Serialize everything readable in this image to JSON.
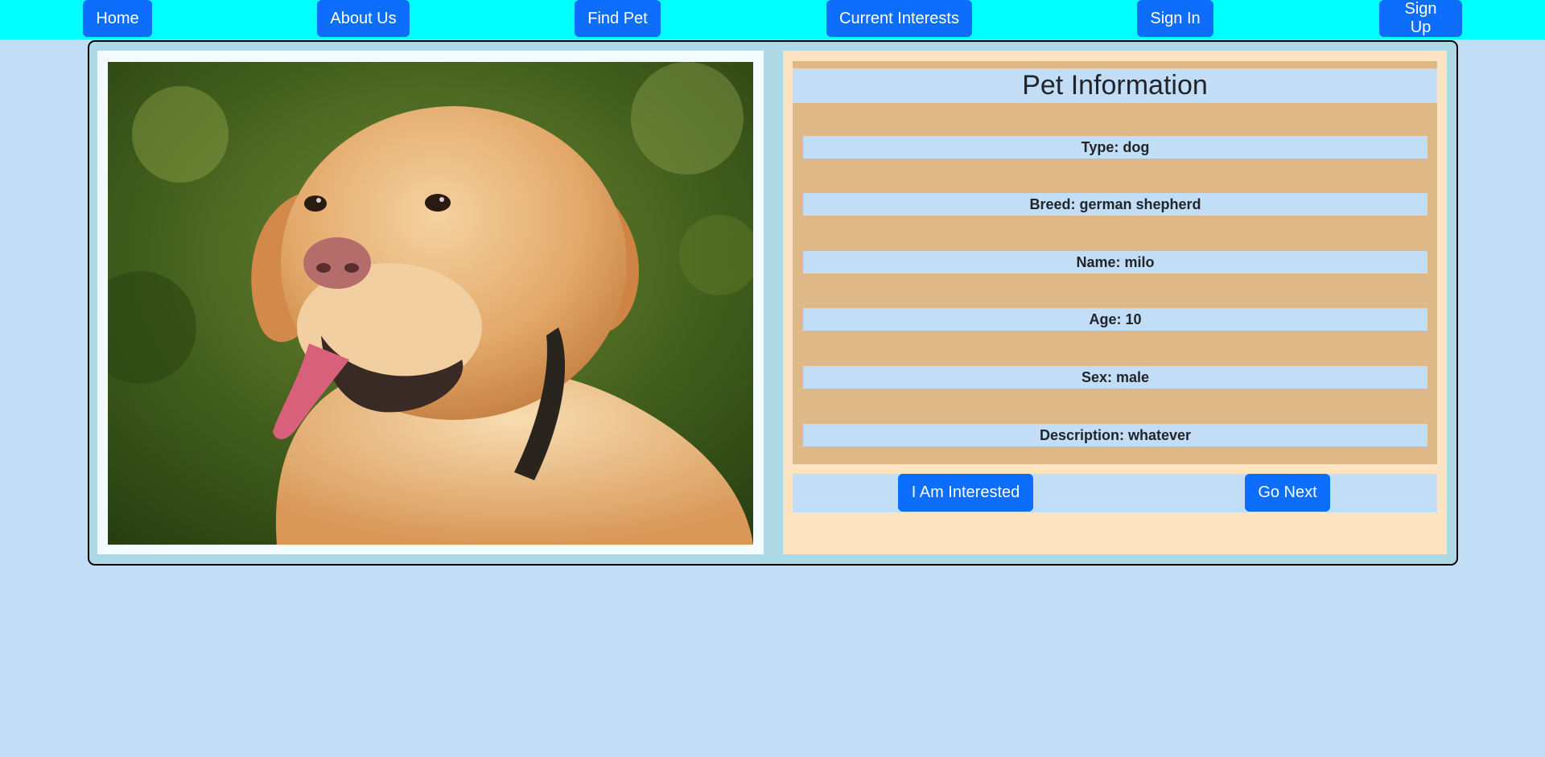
{
  "nav": {
    "home": "Home",
    "about": "About Us",
    "find_pet": "Find Pet",
    "current_interests": "Current Interests",
    "sign_in": "Sign In",
    "sign_up": "Sign Up"
  },
  "pet_photo": {
    "icon": "dog-photo"
  },
  "info": {
    "title": "Pet Information",
    "type": "Type: dog",
    "breed": "Breed: german shepherd",
    "name": "Name: milo",
    "age": "Age: 10",
    "sex": "Sex: male",
    "description": "Description: whatever"
  },
  "actions": {
    "interested": "I Am Interested",
    "next": "Go Next"
  },
  "colors": {
    "navbar": "#00ffff",
    "button": "#0d6efd",
    "page_bg": "#c2ddf6",
    "card_bg": "#add8e6",
    "info_bg": "#ffe4c4",
    "info_box": "#deb887"
  }
}
